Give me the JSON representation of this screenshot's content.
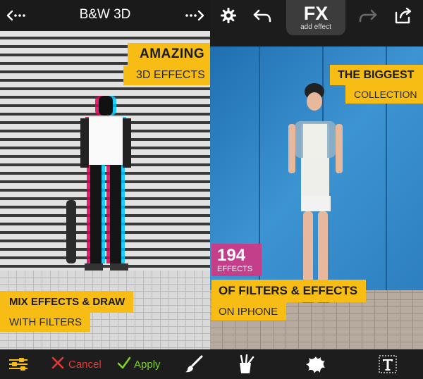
{
  "left": {
    "title": "B&W 3D",
    "prev_icon": "back-dotted-arrow-icon",
    "next_icon": "forward-dotted-arrow-icon",
    "banner_top_main": "AMAZING",
    "banner_top_sub": "3D EFFECTS",
    "banner_bottom_main": "MIX EFFECTS & DRAW",
    "banner_bottom_sub": "WITH FILTERS",
    "toolbar": {
      "adjust_icon": "sliders-icon",
      "cancel_label": "Cancel",
      "apply_label": "Apply",
      "brush_icon": "brush-icon"
    },
    "colors": {
      "accent": "#f7bd14",
      "cancel": "#e53935",
      "apply": "#7ed321"
    }
  },
  "right": {
    "toolbar_top": {
      "settings_icon": "gear-icon",
      "undo_icon": "undo-icon",
      "fx_label": "FX",
      "fx_sublabel": "add effect",
      "redo_icon": "redo-icon",
      "share_icon": "share-icon"
    },
    "banner_top_main": "THE BIGGEST",
    "banner_top_sub": "COLLECTION",
    "count_number": "194",
    "count_label": "EFFECTS",
    "banner_bottom_main": "OF FILTERS & EFFECTS",
    "banner_bottom_sub": "ON IPHONE",
    "toolbar_bottom": {
      "tools_icon": "paint-tools-icon",
      "splash_icon": "splash-icon",
      "text_icon": "text-icon"
    },
    "colors": {
      "accent": "#f7bd14",
      "badge": "#c33f8a"
    }
  }
}
